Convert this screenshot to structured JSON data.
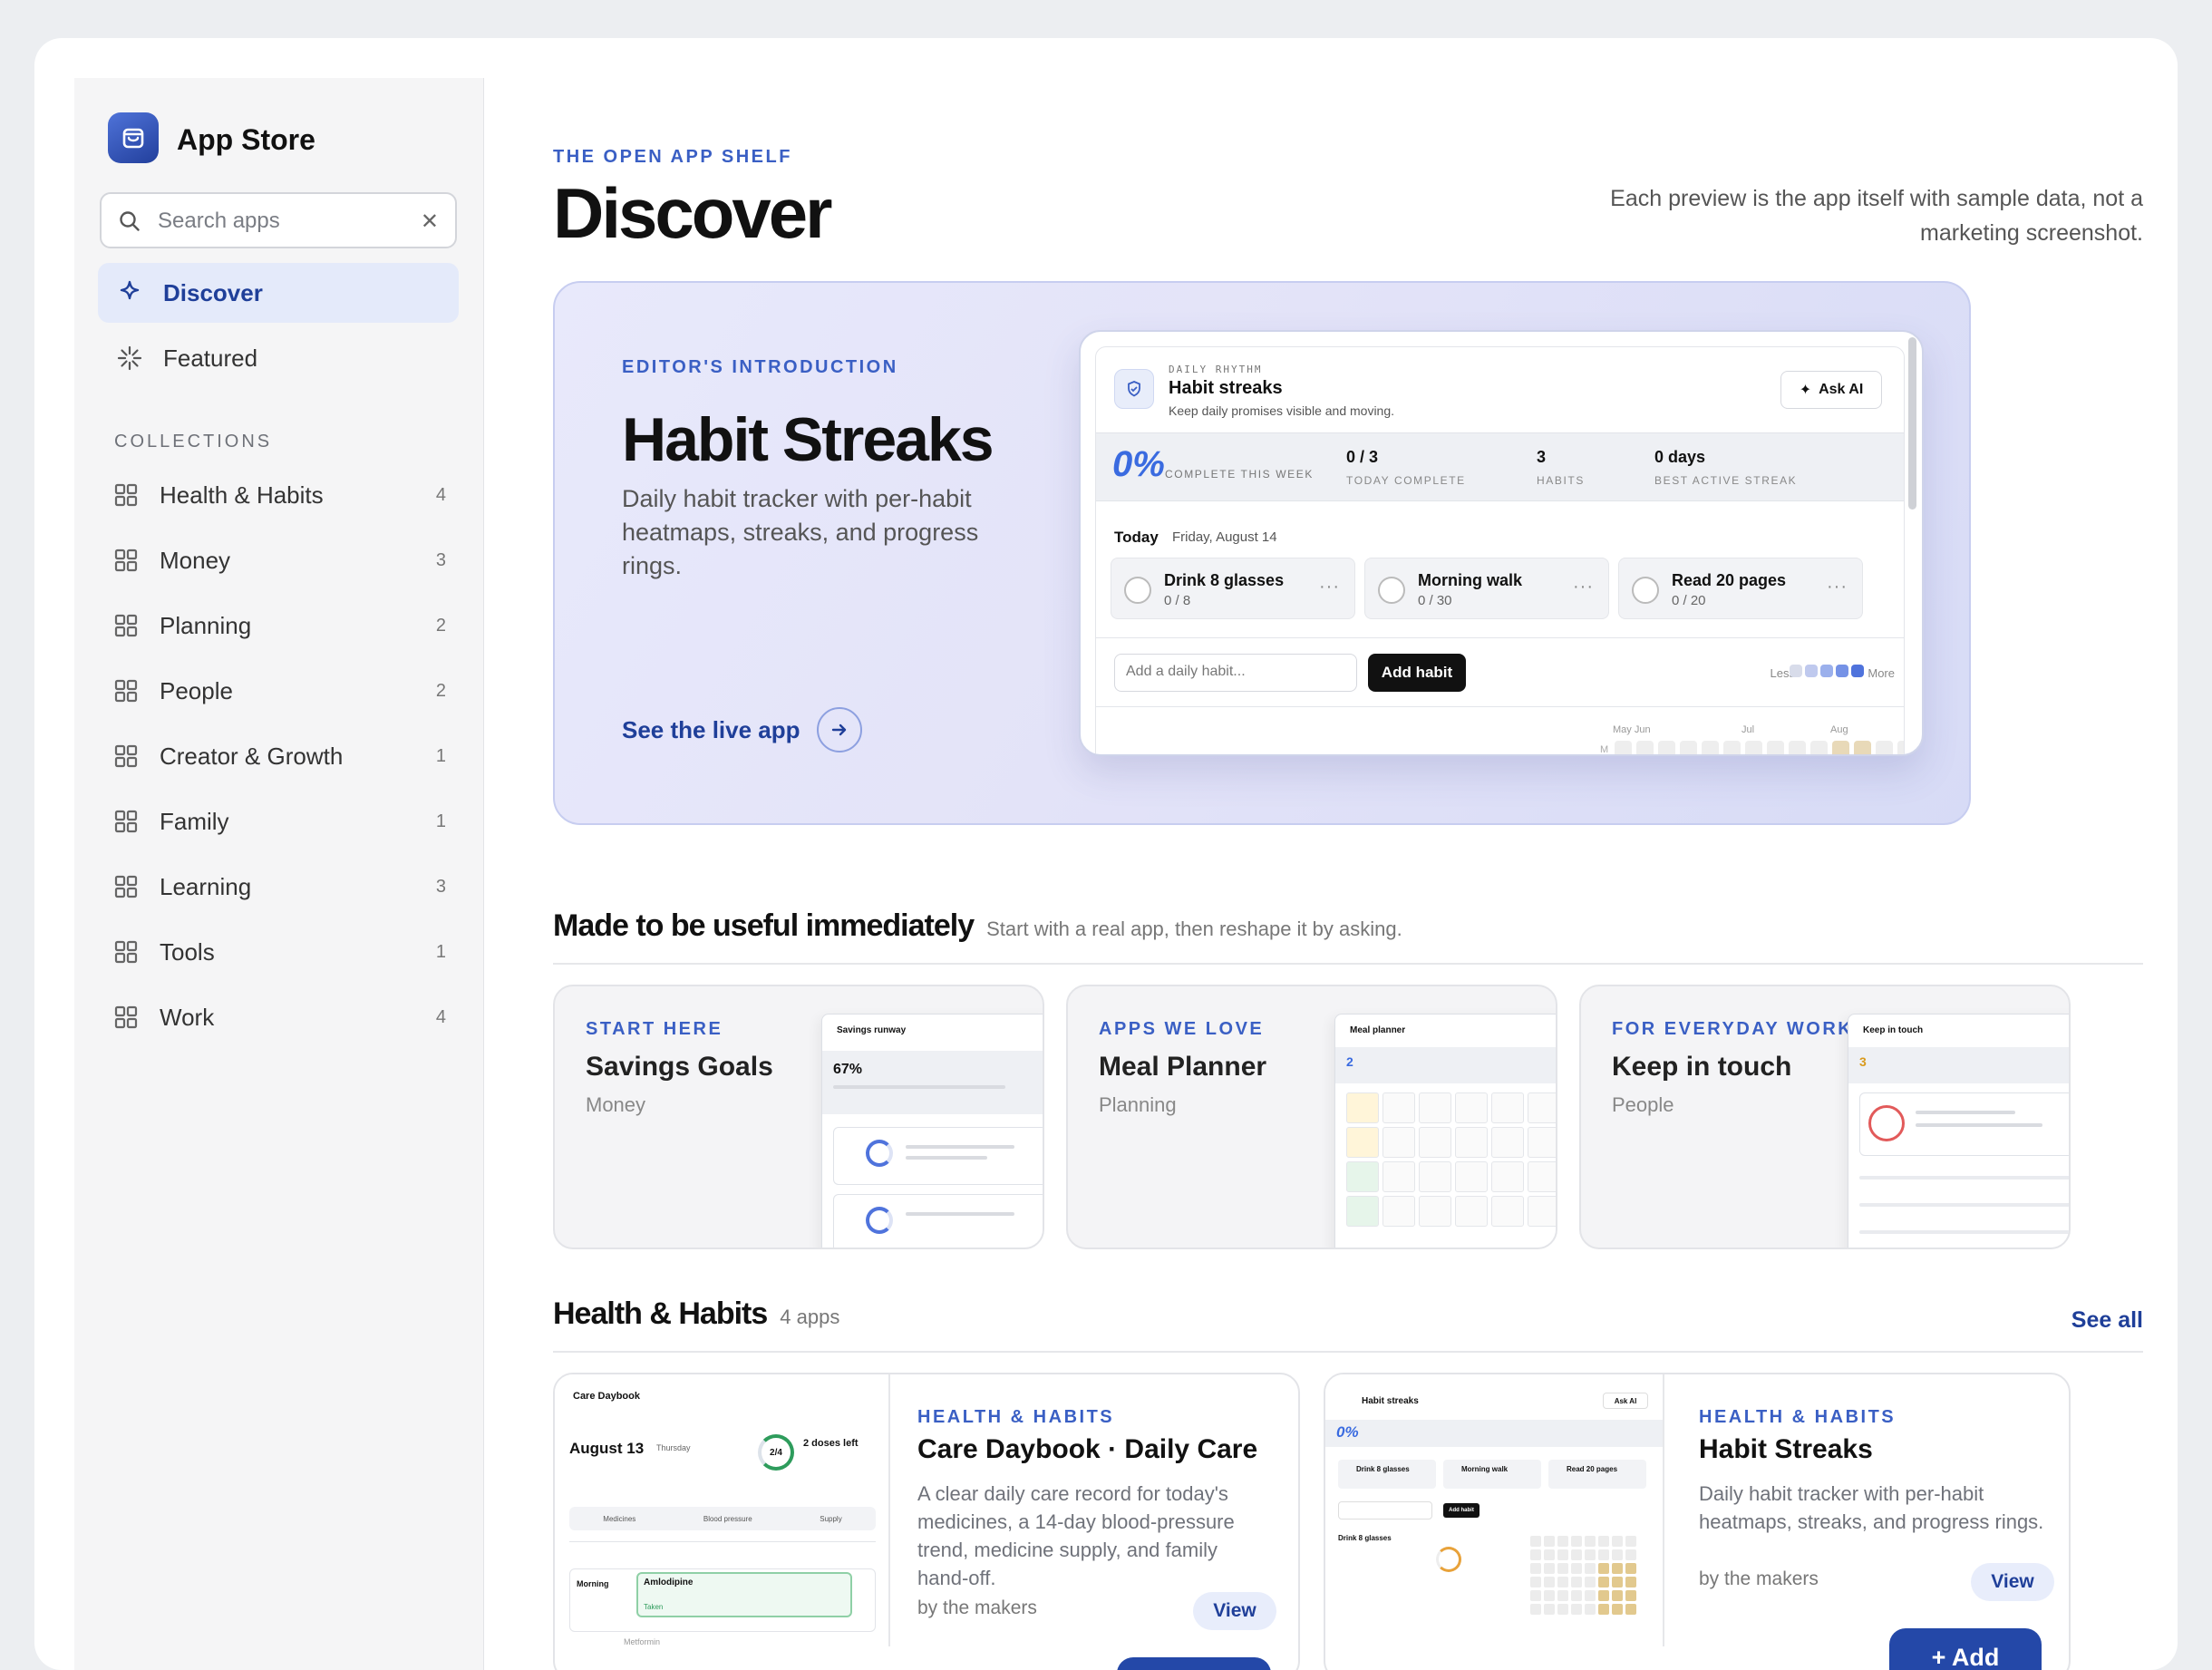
{
  "sidebar": {
    "brand": "App Store",
    "search_placeholder": "Search apps",
    "nav": [
      {
        "label": "Discover"
      },
      {
        "label": "Featured"
      }
    ],
    "collections_heading": "COLLECTIONS",
    "collections": [
      {
        "label": "Health & Habits",
        "count": "4"
      },
      {
        "label": "Money",
        "count": "3"
      },
      {
        "label": "Planning",
        "count": "2"
      },
      {
        "label": "People",
        "count": "2"
      },
      {
        "label": "Creator & Growth",
        "count": "1"
      },
      {
        "label": "Family",
        "count": "1"
      },
      {
        "label": "Learning",
        "count": "3"
      },
      {
        "label": "Tools",
        "count": "1"
      },
      {
        "label": "Work",
        "count": "4"
      }
    ]
  },
  "header": {
    "eyebrow": "THE OPEN APP SHELF",
    "title": "Discover",
    "note": "Each preview is the app itself with sample data, not a marketing screenshot."
  },
  "hero": {
    "eyebrow": "EDITOR'S INTRODUCTION",
    "title": "Habit Streaks",
    "description": "Daily habit tracker with per-habit heatmaps, streaks, and progress rings.",
    "cta": "See the live app",
    "preview": {
      "eyebrow": "DAILY RHYTHM",
      "app_title": "Habit streaks",
      "subtitle": "Keep daily promises visible and moving.",
      "ask_ai": "Ask AI",
      "percent": "0%",
      "percent_label": "COMPLETE THIS WEEK",
      "stats": [
        {
          "value": "0 / 3",
          "label": "TODAY COMPLETE"
        },
        {
          "value": "3",
          "label": "HABITS"
        },
        {
          "value": "0 days",
          "label": "BEST ACTIVE STREAK"
        }
      ],
      "today_label": "Today",
      "date": "Friday, August 14",
      "habits": [
        {
          "name": "Drink 8 glasses",
          "progress": "0 / 8"
        },
        {
          "name": "Morning walk",
          "progress": "0 / 30"
        },
        {
          "name": "Read 20 pages",
          "progress": "0 / 20"
        }
      ],
      "input_placeholder": "Add a daily habit...",
      "add_button": "Add habit",
      "legend_less": "Less",
      "legend_more": "More",
      "months": [
        "May Jun",
        "Jul",
        "Aug"
      ],
      "row_label": "M"
    }
  },
  "useful": {
    "title": "Made to be useful immediately",
    "subtitle": "Start with a real app, then reshape it by asking.",
    "cards": [
      {
        "eyebrow": "START HERE",
        "title": "Savings Goals",
        "category": "Money",
        "shot_title": "Savings runway",
        "shot_value": "67%"
      },
      {
        "eyebrow": "APPS WE LOVE",
        "title": "Meal Planner",
        "category": "Planning",
        "shot_title": "Meal planner",
        "shot_value": "2"
      },
      {
        "eyebrow": "FOR EVERYDAY WORK",
        "title": "Keep in touch",
        "category": "People",
        "shot_title": "Keep in touch",
        "shot_value": "3"
      }
    ]
  },
  "health": {
    "title": "Health & Habits",
    "count": "4 apps",
    "see_all": "See all",
    "apps": [
      {
        "eyebrow": "HEALTH & HABITS",
        "title": "Care Daybook · Daily Care",
        "description": "A clear daily care record for today's medicines, a 14-day blood-pressure trend, medicine supply, and family hand-off.",
        "by": "by the makers",
        "view": "View",
        "shot": {
          "app": "Care Daybook",
          "date": "August 13",
          "weekday": "Thursday",
          "ring": "2/4",
          "doses": "2 doses left",
          "tabs": [
            "Medicines",
            "Blood pressure",
            "Supply"
          ],
          "row1": "Morning",
          "med1": "Amlodipine",
          "med2": "Metformin",
          "taken": "Taken"
        }
      },
      {
        "eyebrow": "HEALTH & HABITS",
        "title": "Habit Streaks",
        "description": "Daily habit tracker with per-habit heatmaps, streaks, and progress rings.",
        "by": "by the makers",
        "view": "View",
        "add": "+ Add",
        "shot": {
          "app": "Habit streaks",
          "ask": "Ask AI",
          "percent": "0%",
          "habits": [
            "Drink 8 glasses",
            "Morning walk",
            "Read 20 pages"
          ],
          "add": "Add habit",
          "detail": "Drink 8 glasses"
        }
      }
    ]
  },
  "colors": {
    "accent": "#2448a8",
    "accent_text": "#1f3f99",
    "eyebrow": "#3a5fc4",
    "hero_bg": "#e3e3f8"
  }
}
